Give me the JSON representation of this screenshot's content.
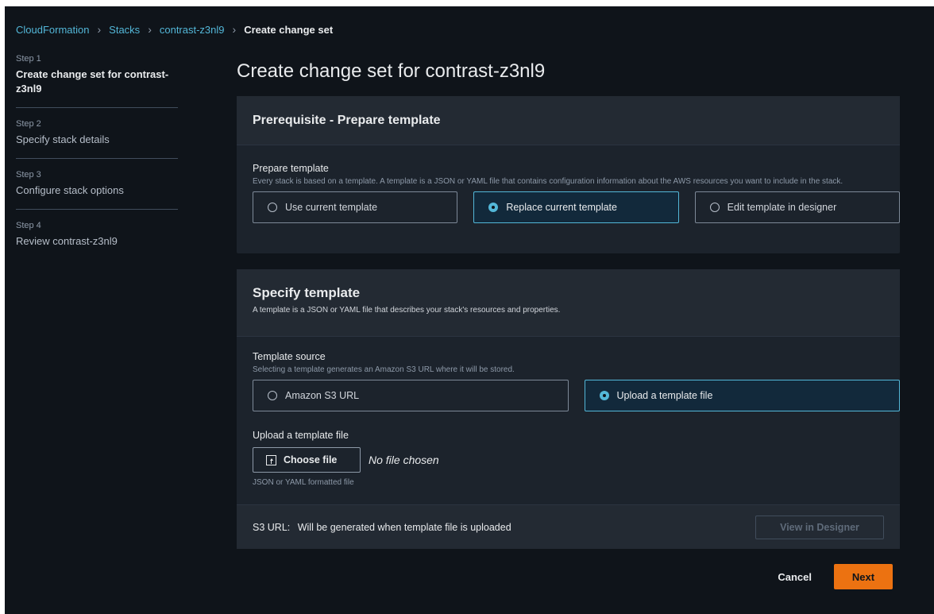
{
  "breadcrumb": {
    "items": [
      "CloudFormation",
      "Stacks",
      "contrast-z3nl9"
    ],
    "current": "Create change set"
  },
  "steps": [
    {
      "num": "Step 1",
      "title": "Create change set for contrast-z3nl9"
    },
    {
      "num": "Step 2",
      "title": "Specify stack details"
    },
    {
      "num": "Step 3",
      "title": "Configure stack options"
    },
    {
      "num": "Step 4",
      "title": "Review contrast-z3nl9"
    }
  ],
  "page_title": "Create change set for contrast-z3nl9",
  "prerequisite": {
    "title": "Prerequisite - Prepare template",
    "field_label": "Prepare template",
    "field_desc": "Every stack is based on a template. A template is a JSON or YAML file that contains configuration information about the AWS resources you want to include in the stack.",
    "options": [
      "Use current template",
      "Replace current template",
      "Edit template in designer"
    ],
    "selected": "Replace current template"
  },
  "specify": {
    "title": "Specify template",
    "desc": "A template is a JSON or YAML file that describes your stack's resources and properties.",
    "source_label": "Template source",
    "source_desc": "Selecting a template generates an Amazon S3 URL where it will be stored.",
    "options": [
      "Amazon S3 URL",
      "Upload a template file"
    ],
    "selected": "Upload a template file",
    "upload_label": "Upload a template file",
    "choose_file": "Choose file",
    "no_file": "No file chosen",
    "upload_hint": "JSON or YAML formatted file",
    "s3_label": "S3 URL:",
    "s3_value": "Will be generated when template file is uploaded",
    "view_designer": "View in Designer"
  },
  "actions": {
    "cancel": "Cancel",
    "next": "Next"
  },
  "colors": {
    "background": "#0f141a",
    "panel": "#1c232c",
    "link": "#53b7d8",
    "primary": "#ec7211"
  }
}
